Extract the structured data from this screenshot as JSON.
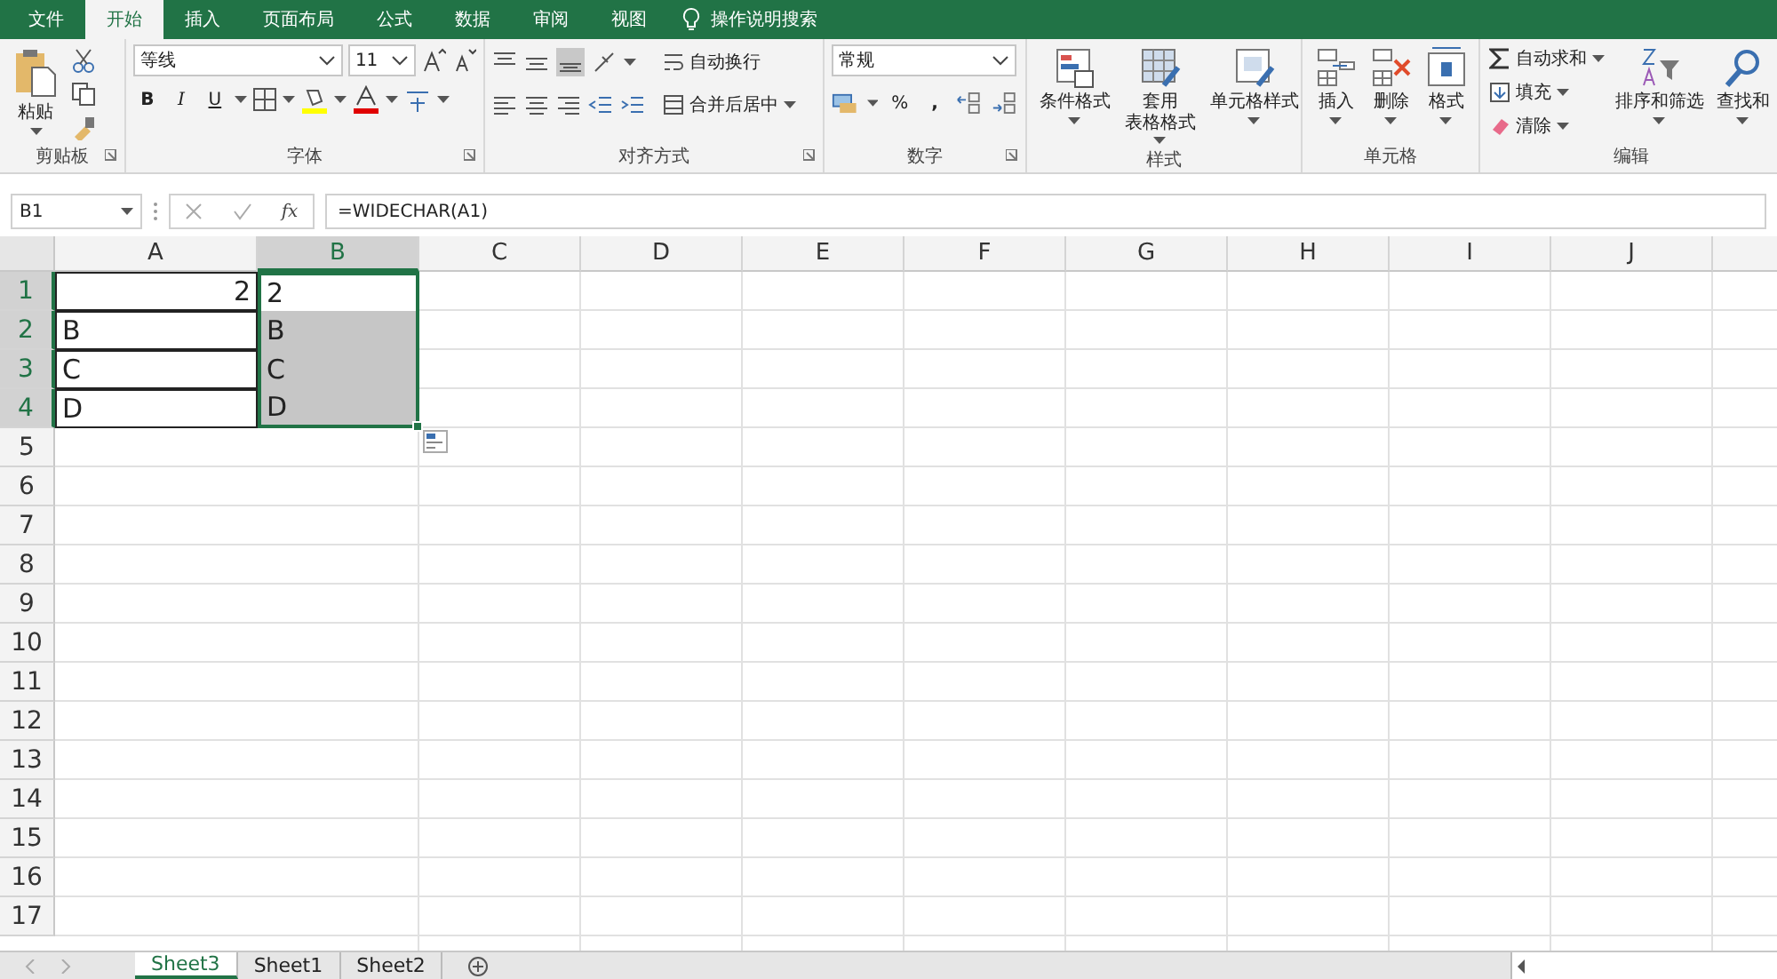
{
  "tabs": [
    {
      "label": "文件",
      "selected": false
    },
    {
      "label": "开始",
      "selected": true
    },
    {
      "label": "插入",
      "selected": false
    },
    {
      "label": "页面布局",
      "selected": false
    },
    {
      "label": "公式",
      "selected": false
    },
    {
      "label": "数据",
      "selected": false
    },
    {
      "label": "审阅",
      "selected": false
    },
    {
      "label": "视图",
      "selected": false
    }
  ],
  "tell_me": "操作说明搜索",
  "ribbon": {
    "clipboard": {
      "paste": "粘贴",
      "label": "剪贴板"
    },
    "font": {
      "font_name": "等线",
      "font_size": "11",
      "bold": "B",
      "italic": "I",
      "underline": "U",
      "label": "字体"
    },
    "alignment": {
      "wrap": "自动换行",
      "merge": "合并后居中",
      "label": "对齐方式"
    },
    "number": {
      "format": "常规",
      "percent": "%",
      "comma": ",",
      "label": "数字"
    },
    "styles": {
      "buttons": [
        {
          "lines": [
            "条件格式"
          ]
        },
        {
          "lines": [
            "套用",
            "表格格式"
          ]
        },
        {
          "lines": [
            "单元格样式"
          ]
        }
      ],
      "label": "样式"
    },
    "cells": {
      "buttons": [
        "插入",
        "删除",
        "格式"
      ],
      "label": "单元格"
    },
    "editing": {
      "items": [
        "自动求和",
        "填充",
        "清除"
      ],
      "sort": "排序和筛选",
      "find": "查找和",
      "label": "编辑"
    }
  },
  "formula_bar": {
    "name_box": "B1",
    "fx": "fx",
    "formula": "=WIDECHAR(A1)"
  },
  "columns": [
    {
      "label": "A",
      "selected": false
    },
    {
      "label": "B",
      "selected": true
    },
    {
      "label": "C",
      "selected": false
    },
    {
      "label": "D",
      "selected": false
    },
    {
      "label": "E",
      "selected": false
    },
    {
      "label": "F",
      "selected": false
    },
    {
      "label": "G",
      "selected": false
    },
    {
      "label": "H",
      "selected": false
    },
    {
      "label": "I",
      "selected": false
    },
    {
      "label": "J",
      "selected": false
    }
  ],
  "rows": [
    {
      "label": "1",
      "selected": true,
      "cells": [
        {
          "kind": "number",
          "value": "2",
          "bordered": true
        },
        {
          "value": "2",
          "selected": true,
          "active": true
        }
      ]
    },
    {
      "label": "2",
      "selected": true,
      "cells": [
        {
          "value": "B",
          "bordered": true
        },
        {
          "value": "B",
          "selected": true
        }
      ]
    },
    {
      "label": "3",
      "selected": true,
      "cells": [
        {
          "value": "C",
          "bordered": true
        },
        {
          "value": "C",
          "selected": true
        }
      ]
    },
    {
      "label": "4",
      "selected": true,
      "cells": [
        {
          "value": "D",
          "bordered": true
        },
        {
          "value": "D",
          "selected": true
        }
      ]
    },
    {
      "label": "5",
      "selected": false
    },
    {
      "label": "6",
      "selected": false
    },
    {
      "label": "7",
      "selected": false
    },
    {
      "label": "8",
      "selected": false
    },
    {
      "label": "9",
      "selected": false
    },
    {
      "label": "10",
      "selected": false
    },
    {
      "label": "11",
      "selected": false
    },
    {
      "label": "12",
      "selected": false
    },
    {
      "label": "13",
      "selected": false
    },
    {
      "label": "14",
      "selected": false
    },
    {
      "label": "15",
      "selected": false
    },
    {
      "label": "16",
      "selected": false
    },
    {
      "label": "17",
      "selected": false
    }
  ],
  "sheets": [
    {
      "label": "Sheet3",
      "selected": true
    },
    {
      "label": "Sheet1",
      "selected": false
    },
    {
      "label": "Sheet2",
      "selected": false
    }
  ]
}
